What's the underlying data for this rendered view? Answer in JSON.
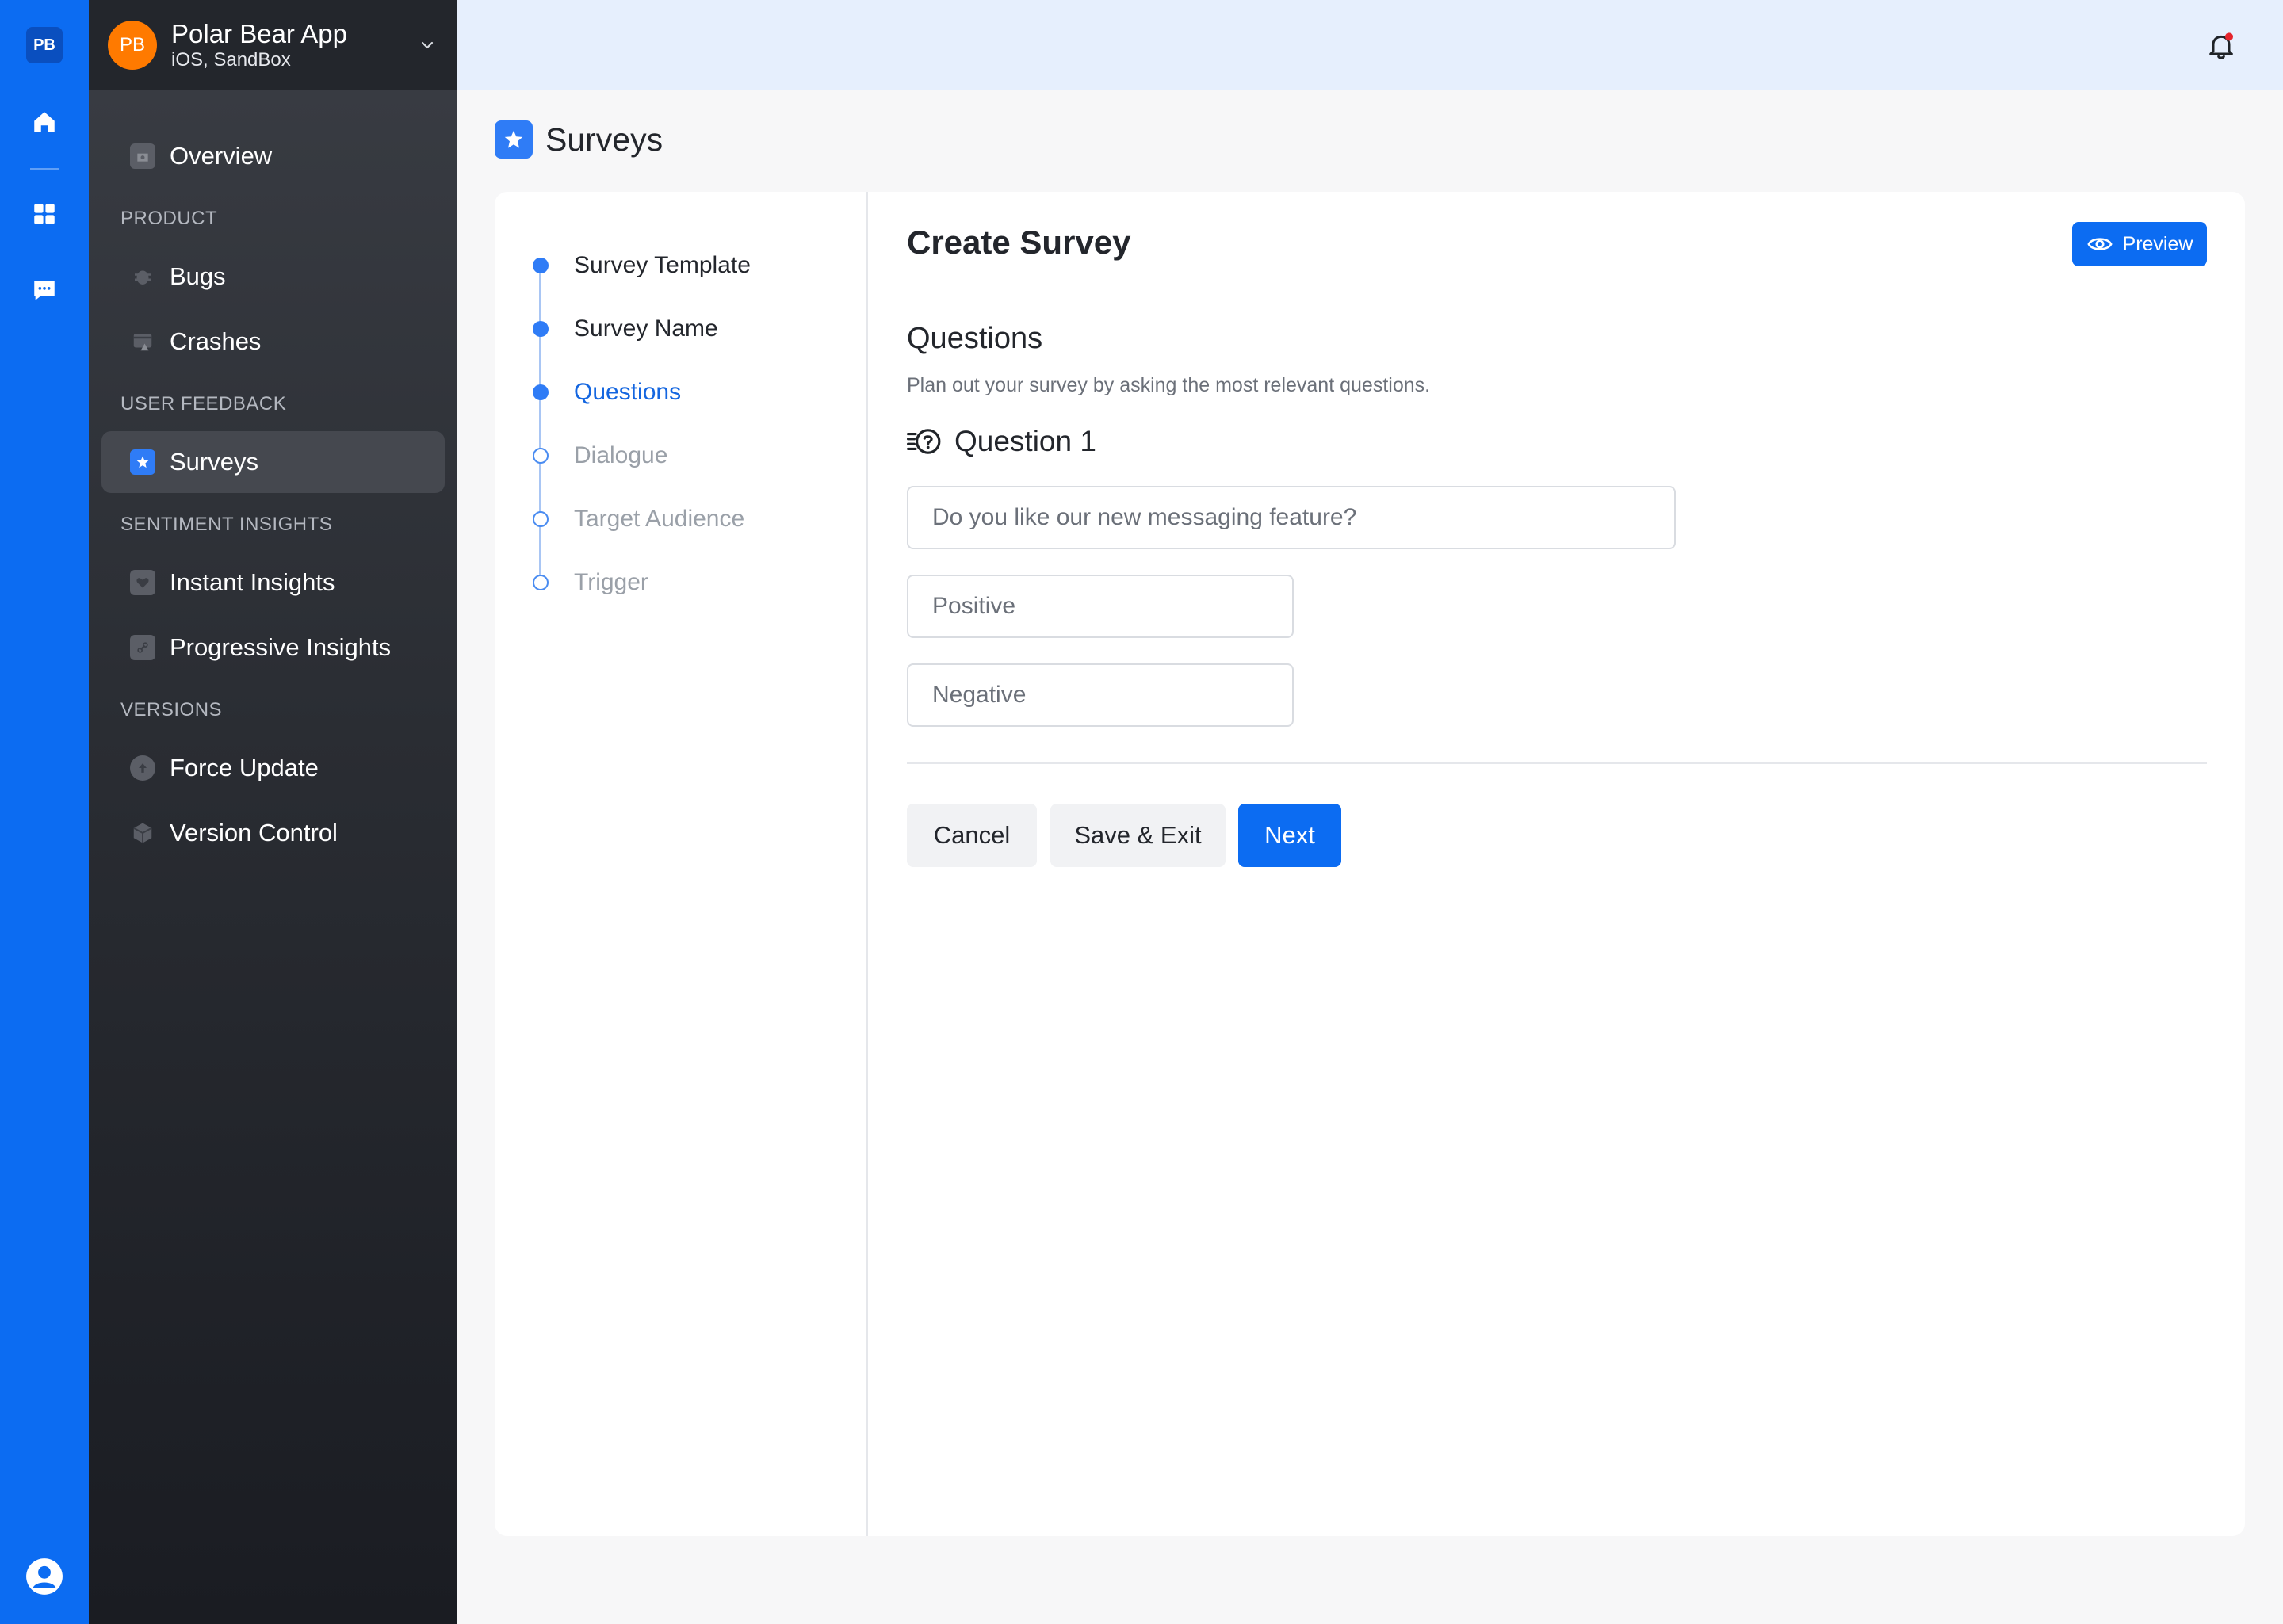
{
  "rail": {
    "logo": "PB"
  },
  "workspace": {
    "initials": "PB",
    "name": "Polar Bear App",
    "sub": "iOS, SandBox"
  },
  "nav": {
    "overview": "Overview",
    "product_section": "PRODUCT",
    "bugs": "Bugs",
    "crashes": "Crashes",
    "feedback_section": "USER FEEDBACK",
    "surveys": "Surveys",
    "sentiment_section": "SENTIMENT INSIGHTS",
    "instant": "Instant Insights",
    "progressive": "Progressive Insights",
    "versions_section": "VERSIONS",
    "force_update": "Force Update",
    "version_control": "Version Control"
  },
  "page": {
    "title": "Surveys"
  },
  "steps": [
    {
      "label": "Survey Template",
      "state": "done"
    },
    {
      "label": "Survey Name",
      "state": "done"
    },
    {
      "label": "Questions",
      "state": "current"
    },
    {
      "label": "Dialogue",
      "state": "pending"
    },
    {
      "label": "Target Audience",
      "state": "pending"
    },
    {
      "label": "Trigger",
      "state": "pending"
    }
  ],
  "content": {
    "title": "Create Survey",
    "preview": "Preview",
    "section_title": "Questions",
    "section_desc": "Plan out your survey by asking the most relevant questions.",
    "question_title": "Question 1",
    "question_value": "Do you like our new messaging feature?",
    "positive_value": "Positive",
    "negative_value": "Negative",
    "cancel": "Cancel",
    "save_exit": "Save & Exit",
    "next": "Next"
  },
  "colors": {
    "accent": "#0c6cf2",
    "avatar": "#ff7a00",
    "notification": "#e5242c"
  }
}
